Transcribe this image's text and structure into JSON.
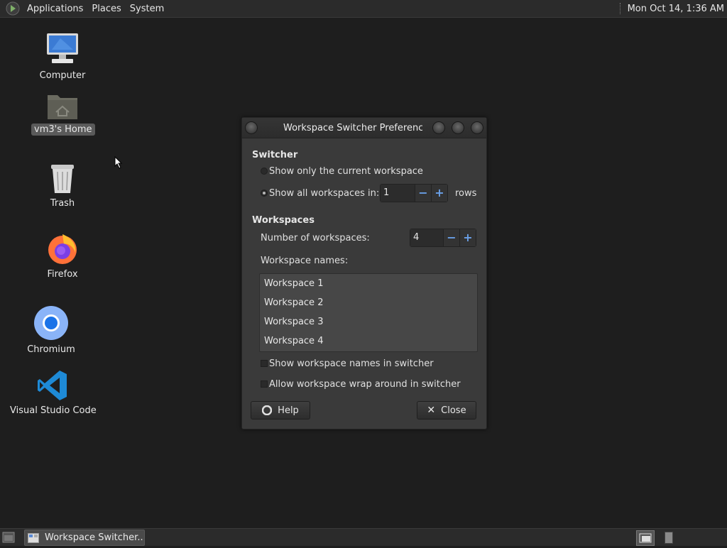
{
  "top_panel": {
    "menus": [
      "Applications",
      "Places",
      "System"
    ],
    "clock": "Mon Oct 14,  1:36 AM"
  },
  "desktop": {
    "icons": [
      {
        "label": "Computer"
      },
      {
        "label": "vm3's Home"
      },
      {
        "label": "Trash"
      },
      {
        "label": "Firefox"
      },
      {
        "label": "Chromium"
      },
      {
        "label": "Visual Studio Code"
      }
    ]
  },
  "dialog": {
    "title": "Workspace Switcher Preferences",
    "switcher_section": "Switcher",
    "show_current_label": "Show only the current workspace",
    "show_all_label": "Show all workspaces in:",
    "rows_value": "1",
    "rows_suffix": "rows",
    "workspaces_section": "Workspaces",
    "num_workspaces_label": "Number of workspaces:",
    "num_workspaces_value": "4",
    "workspace_names_label": "Workspace names:",
    "workspace_names": [
      "Workspace 1",
      "Workspace 2",
      "Workspace 3",
      "Workspace 4"
    ],
    "show_names_label": "Show workspace names in switcher",
    "wrap_label": "Allow workspace wrap around in switcher",
    "help_label": "Help",
    "close_label": "Close",
    "minus_symbol": "−",
    "plus_symbol": "+"
  },
  "bottom_panel": {
    "task_label": "Workspace Switcher..."
  },
  "colors": {
    "desktop_bg": "#1e1e1e",
    "panel_bg": "#2b2b2b",
    "dialog_bg": "#3a3a3a",
    "spin_accent": "#6aa0e8"
  }
}
